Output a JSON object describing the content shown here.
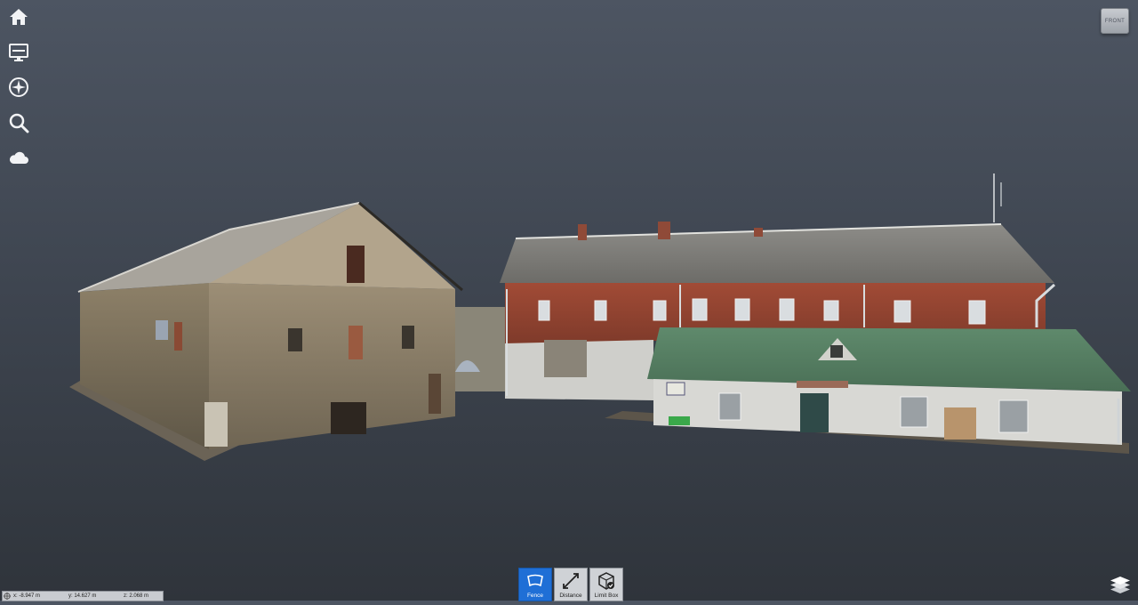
{
  "left_toolbar": [
    {
      "icon": "home-icon",
      "name": "home-button"
    },
    {
      "icon": "monitor-icon",
      "name": "screen-button"
    },
    {
      "icon": "compass-icon",
      "name": "navigation-button"
    },
    {
      "icon": "search-icon",
      "name": "search-button"
    },
    {
      "icon": "cloud-icon",
      "name": "point-cloud-button"
    }
  ],
  "view_cube": {
    "label": "FRONT"
  },
  "coordinates": {
    "x": "x:  -8.947 m",
    "y": "y:  14.627 m",
    "z": "z:  2.068 m"
  },
  "bottom_tools": [
    {
      "label": "Fence",
      "icon": "fence-icon",
      "active": true
    },
    {
      "label": "Distance",
      "icon": "distance-icon",
      "active": false
    },
    {
      "label": "Limit Box",
      "icon": "limit-box-icon",
      "active": false
    }
  ],
  "colors": {
    "accent": "#1f6fd6",
    "background_top": "#4d5562",
    "background_bottom": "#2f343b"
  }
}
